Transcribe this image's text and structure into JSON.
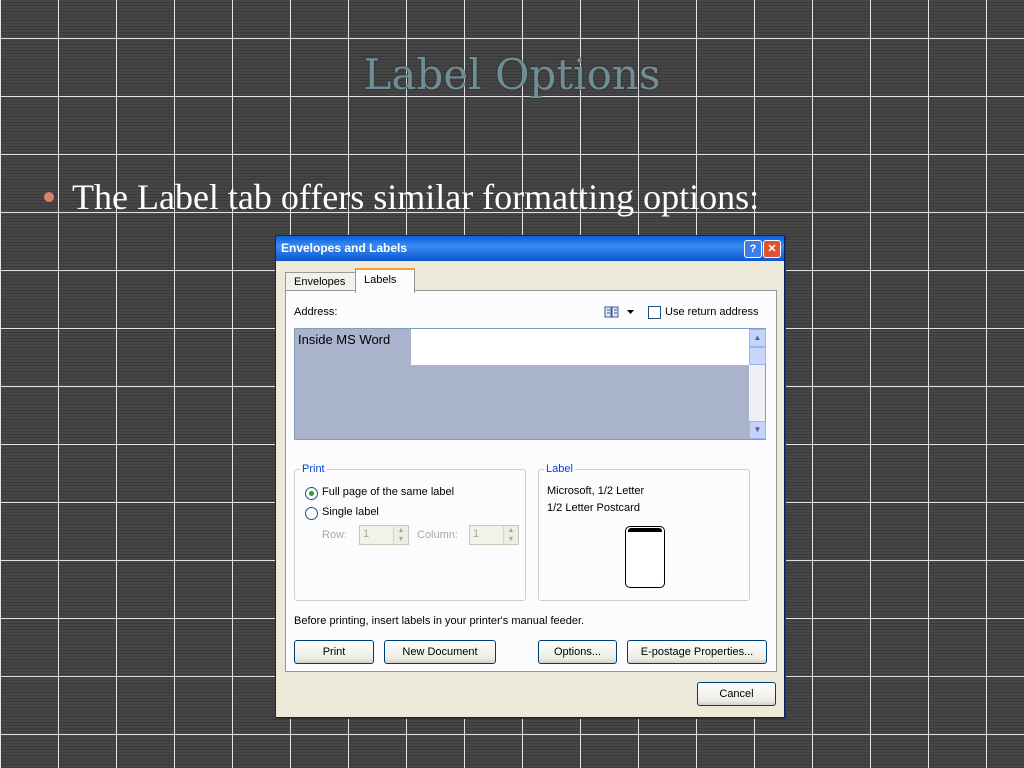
{
  "slide": {
    "title": "Label Options",
    "bullet": "The Label tab offers similar formatting options:"
  },
  "dialog": {
    "title": "Envelopes and Labels",
    "help_glyph": "?",
    "close_glyph": "✕",
    "tabs": [
      {
        "label": "Envelopes",
        "active": false
      },
      {
        "label": "Labels",
        "active": true
      }
    ],
    "address_label": "Address:",
    "address_value": "Inside MS Word",
    "use_return_address": "Use return address",
    "print_group": {
      "title": "Print",
      "options": [
        {
          "label": "Full page of the same label",
          "selected": true
        },
        {
          "label": "Single label",
          "selected": false
        }
      ],
      "row_label": "Row:",
      "row_value": "1",
      "column_label": "Column:",
      "column_value": "1"
    },
    "label_group": {
      "title": "Label",
      "line1": "Microsoft, 1/2 Letter",
      "line2": "1/2 Letter Postcard"
    },
    "note": "Before printing, insert labels in your printer's manual feeder.",
    "buttons": {
      "print": "Print",
      "new_document": "New Document",
      "options": "Options...",
      "epostage": "E-postage Properties...",
      "cancel": "Cancel"
    }
  }
}
